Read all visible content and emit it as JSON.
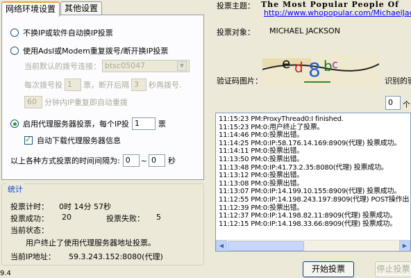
{
  "tabs": [
    "网络环境设置",
    "其他设置"
  ],
  "options": {
    "radio1": "不换IP或软件自动换IP投票",
    "radio2": "使用Adsl或Modem重复拨号/断开换IP投票",
    "dial_label": "当前默认的拨号连接：",
    "dial_value": "btsc05047",
    "every_prefix": "每次拨号投",
    "every_count": "1",
    "every_mid": "票，断开后隔",
    "every_wait": "3",
    "every_suffix": "秒再拨号.",
    "repeat_minutes": "60",
    "repeat_label": "分钟内IP重复即自动重拨",
    "radio3": "启用代理服务器投票，每个IP投",
    "proxy_count": "1",
    "proxy_unit": "票",
    "auto_download": "自动下载代理服务器信息",
    "interval_label": "以上各种方式投票的时间间隔为:",
    "interval_from": "0",
    "interval_sep": "~",
    "interval_to": "0",
    "interval_unit": "秒"
  },
  "stats": {
    "title": "统计",
    "timer_label": "投票计时：",
    "timer_value": "0时 14分 57秒",
    "success_label": "投票成功：",
    "success_value": "20",
    "fail_label": "投票失败：",
    "fail_value": "5",
    "state_label": "当前状态：",
    "state_value": "用户终止了使用代理服务器地址投票。",
    "ip_label": "当前IP地址：",
    "ip_value": "59.3.243.152:8080(代理)"
  },
  "status_bar": "9.4",
  "right": {
    "theme_label": "投票主题：",
    "theme_value": "The Most Popular People Of",
    "theme_link": "http://www.whopopular.com/MichaelJacks",
    "target_label": "投票对象：",
    "target_value": "MICHAEL JACKSON",
    "captcha_label": "验证码图片：",
    "captcha_text": "ed8bc",
    "recognized_label": "识别的验",
    "code_value": "0",
    "code_suffix": "个"
  },
  "log": [
    "11:15:23 PM:ProxyThread0:I finished.",
    "11:15:23 PM:0:用户终止了投票。",
    "11:14:46 PM:0:投票出错。",
    "11:14:25 PM:0:IP:58.176.14.169:8909(代理) 投票成功。",
    "11:14:11 PM:0:投票出错。",
    "11:13:50 PM:0:投票出错。",
    "11:13:48 PM:0:IP:41.73.2.35:8080(代理) 投票成功。",
    "11:13:12 PM:0:投票出错。",
    "11:13:08 PM:0:投票出错。",
    "11:13:07 PM:0:IP:14.199.10.155:8909(代理) 投票成功。",
    "11:12:55 PM:0:IP:14.198.243.197:8909(代理) POST操作出",
    "11:12:39 PM:0:投票出错。",
    "11:12:37 PM:0:IP:14.198.82.11:8909(代理) 投票成功。",
    "11:12:15 PM:0:IP:14.198.33.66:8909(代理) 投票成功。"
  ],
  "buttons": {
    "start": "开始投票",
    "stop": "停止投票"
  }
}
